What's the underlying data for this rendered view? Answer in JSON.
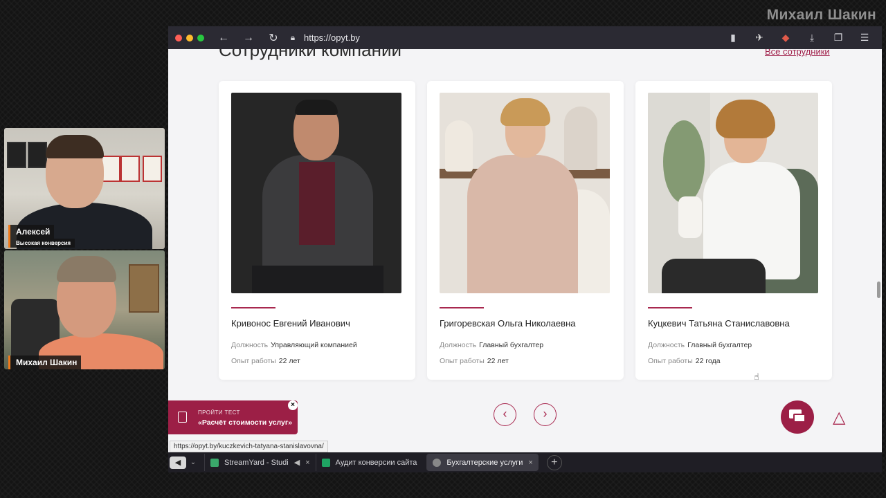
{
  "stream": {
    "presenter_name": "Михаил Шакин"
  },
  "cams": [
    {
      "name": "Алексей",
      "subtitle": "Высокая конверсия"
    },
    {
      "name": "Михаил Шакин"
    }
  ],
  "browser": {
    "url": "https://opyt.by",
    "status_url": "https://opyt.by/kuczkevich-tatyana-stanislavovna/"
  },
  "page": {
    "section_title": "Сотрудники компании",
    "all_link": "Все сотрудники",
    "employees": [
      {
        "name": "Кривонос Евгений Иванович",
        "position_label": "Должность",
        "position": "Управляющий компанией",
        "exp_label": "Опыт работы",
        "exp": "22 лет"
      },
      {
        "name": "Григоревская Ольга Николаевна",
        "position_label": "Должность",
        "position": "Главный бухгалтер",
        "exp_label": "Опыт работы",
        "exp": "22 лет"
      },
      {
        "name": "Куцкевич Татьяна Станиславовна",
        "position_label": "Должность",
        "position": "Главный бухгалтер",
        "exp_label": "Опыт работы",
        "exp": "22 года"
      }
    ],
    "test_banner": {
      "small": "ПРОЙТИ ТЕСТ",
      "big": "«Расчёт стоимости услуг»"
    }
  },
  "tabs": [
    {
      "title": "StreamYard - Studi",
      "favicon_color": "#3aa86b"
    },
    {
      "title": "Аудит конверсии сайта",
      "favicon_color": "#1fa463"
    },
    {
      "title": "Бухгалтерские услуги",
      "favicon_color": "#888888"
    }
  ],
  "colors": {
    "accent": "#9c1f46",
    "toolbar": "#2b2a33"
  }
}
